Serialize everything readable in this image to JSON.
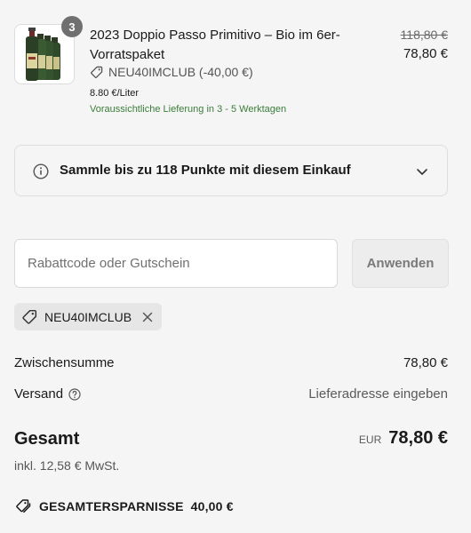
{
  "product": {
    "quantity": "3",
    "title": "2023 Doppio Passo Primitivo – Bio im 6er-Vorratspaket",
    "original_price": "118,80 €",
    "price": "78,80 €",
    "discount_label": "NEU40IMCLUB (-40,00 €)",
    "unit_price": "8.80 €/Liter",
    "delivery_note": "Voraussichtliche Lieferung in 3 - 5 Werktagen",
    "image_icon": "wine-bottles-icon"
  },
  "points": {
    "text": "Sammle bis zu 118 Punkte mit diesem Einkauf",
    "icon": "info-icon"
  },
  "discount_form": {
    "placeholder": "Rabattcode oder Gutschein",
    "value": "",
    "apply_label": "Anwenden"
  },
  "applied_code": {
    "code": "NEU40IMCLUB"
  },
  "summary": {
    "subtotal_label": "Zwischensumme",
    "subtotal_value": "78,80 €",
    "shipping_label": "Versand",
    "shipping_value": "Lieferadresse eingeben",
    "total_label": "Gesamt",
    "currency": "EUR",
    "total_value": "78,80 €",
    "tax_note": "inkl. 12,58 € MwSt.",
    "savings_label": "GESAMTERSPARNISSE",
    "savings_value": "40,00 €"
  },
  "colors": {
    "background": "#f5f5f5",
    "delivery_green": "#3b7d3b",
    "badge_gray": "#707070",
    "muted_text": "#6b6b6b"
  }
}
